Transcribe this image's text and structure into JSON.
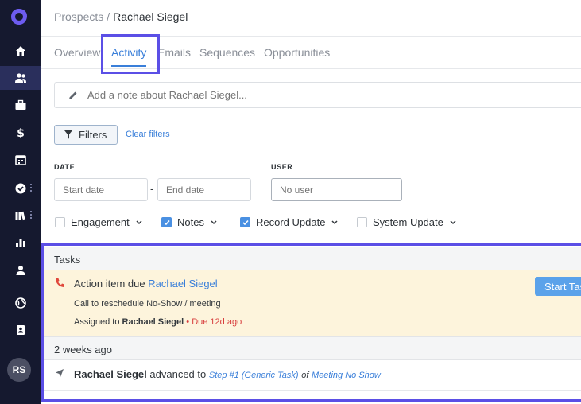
{
  "breadcrumb": {
    "parent": "Prospects",
    "separator": "/",
    "current": "Rachael Siegel"
  },
  "tabs": [
    {
      "label": "Overview"
    },
    {
      "label": "Activity"
    },
    {
      "label": "Emails"
    },
    {
      "label": "Sequences"
    },
    {
      "label": "Opportunities"
    }
  ],
  "note": {
    "placeholder": "Add a note about Rachael Siegel..."
  },
  "filters": {
    "button_label": "Filters",
    "clear_label": "Clear filters",
    "date_label": "DATE",
    "user_label": "USER",
    "start_placeholder": "Start date",
    "end_placeholder": "End date",
    "user_placeholder": "No user",
    "range_separator": "-",
    "types": [
      {
        "label": "Engagement",
        "checked": false
      },
      {
        "label": "Notes",
        "checked": true
      },
      {
        "label": "Record Update",
        "checked": true
      },
      {
        "label": "System Update",
        "checked": false
      }
    ]
  },
  "tasks": {
    "header": "Tasks",
    "item": {
      "title_prefix": "Action item due",
      "title_link": "Rachael Siegel",
      "subtitle": "Call to reschedule No-Show / meeting",
      "assigned_prefix": "Assigned to",
      "assignee": "Rachael Siegel",
      "bullet": "•",
      "due": "Due 12d ago",
      "start_button": "Start Task"
    }
  },
  "history": {
    "header": "2 weeks ago",
    "event": {
      "actor": "Rachael Siegel",
      "verb": "advanced to",
      "step": "Step #1 (Generic Task)",
      "of": "of",
      "sequence": "Meeting No Show"
    }
  },
  "user": {
    "initials": "RS"
  },
  "colors": {
    "sidebar": "#15192f",
    "accent": "#3a7fd9",
    "highlight": "#5b4fe6",
    "task_bg": "#fdf4dc",
    "due": "#d73c3c"
  }
}
